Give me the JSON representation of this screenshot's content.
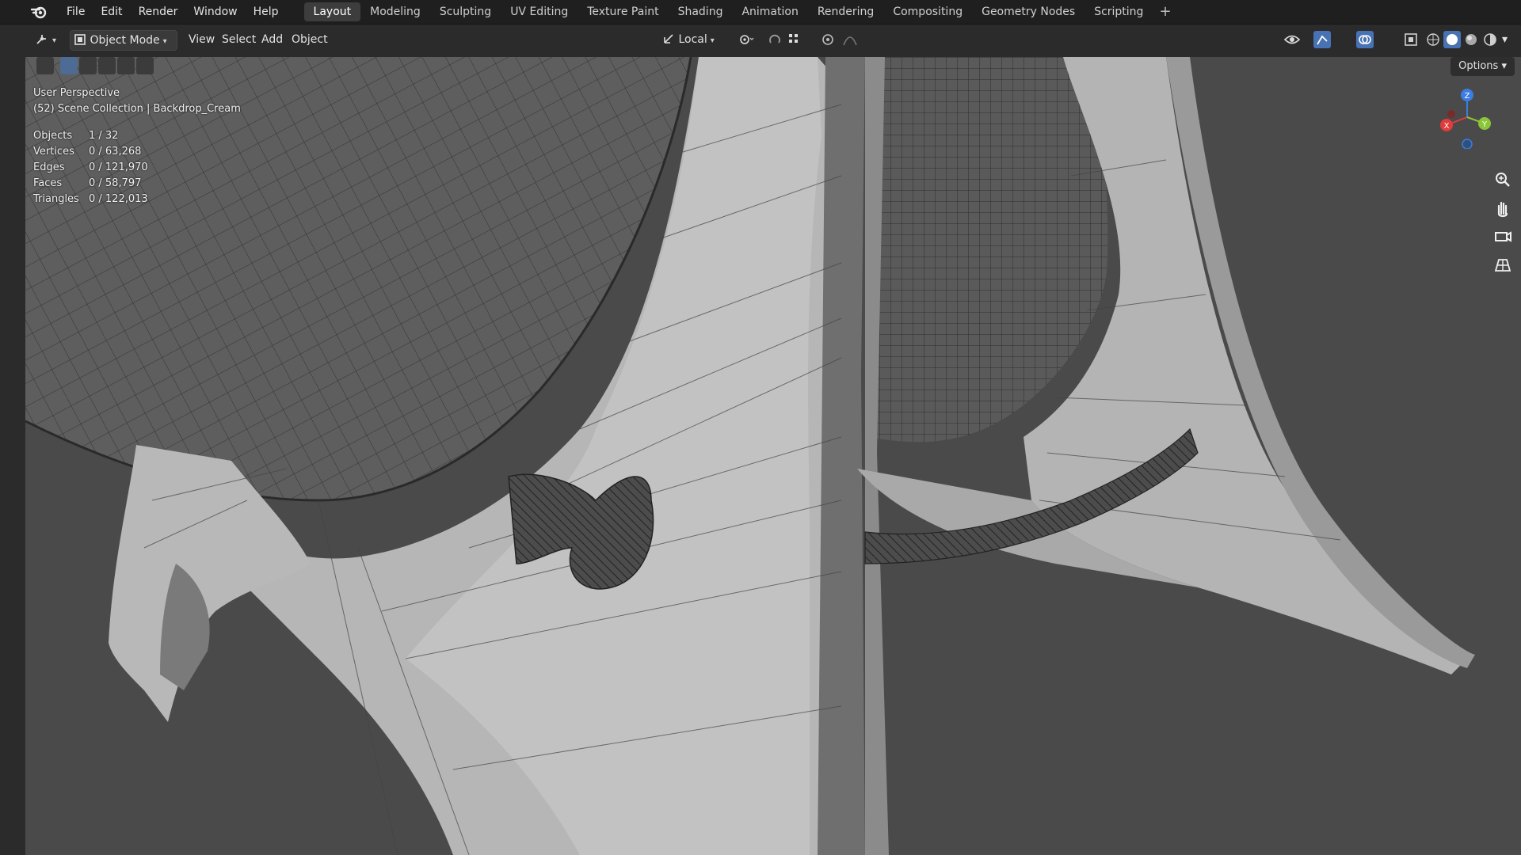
{
  "menu": [
    "File",
    "Edit",
    "Render",
    "Window",
    "Help"
  ],
  "workspaces": [
    "Layout",
    "Modeling",
    "Sculpting",
    "UV Editing",
    "Texture Paint",
    "Shading",
    "Animation",
    "Rendering",
    "Compositing",
    "Geometry Nodes",
    "Scripting"
  ],
  "workspace_add": "+",
  "header": {
    "mode": "Object Mode",
    "view": "View",
    "select": "Select",
    "add": "Add",
    "object": "Object",
    "transform_orientation": "Local",
    "options": "Options"
  },
  "viewport": {
    "title": "User Perspective",
    "collection": "(52) Scene Collection | Backdrop_Cream"
  },
  "stats": [
    {
      "label": "Objects",
      "value": "1 / 32"
    },
    {
      "label": "Vertices",
      "value": "0 / 63,268"
    },
    {
      "label": "Edges",
      "value": "0 / 121,970"
    },
    {
      "label": "Faces",
      "value": "0 / 58,797"
    },
    {
      "label": "Triangles",
      "value": "0 / 122,013"
    }
  ],
  "gizmo": {
    "x": "X",
    "y": "Y",
    "z": "Z",
    "x_color": "#e23b3b",
    "y_color": "#8ac53a",
    "z_color": "#3b7de2"
  },
  "icons": [
    "blender-logo-icon",
    "editor-type-icon",
    "object-mode-icon",
    "transform-orientation-icon",
    "pivot-icon",
    "snap-icon",
    "proportional-icon",
    "visibility-icon",
    "gizmo-icon",
    "overlay-icon",
    "xray-icon",
    "wireframe-shading-icon",
    "solid-shading-icon",
    "material-shading-icon",
    "rendered-shading-icon",
    "zoom-icon",
    "pan-icon",
    "camera-icon",
    "grid-icon"
  ],
  "colors": {
    "viewport_bg": "#4a4a4a",
    "mesh_light": "#b8b8b8",
    "mesh_dark": "#5f5f5f",
    "accent": "#4772b3"
  }
}
